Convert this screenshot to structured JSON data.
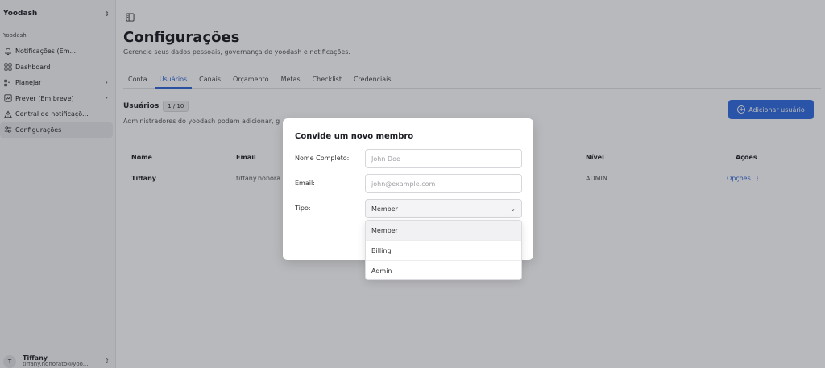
{
  "sidebar": {
    "workspace": "Yoodash",
    "section": "Yoodash",
    "items": [
      {
        "label": "Notificações (Em..."
      },
      {
        "label": "Dashboard"
      },
      {
        "label": "Planejar"
      },
      {
        "label": "Prever (Em breve)"
      },
      {
        "label": "Central de notificaçõ..."
      },
      {
        "label": "Configurações"
      }
    ],
    "user": {
      "initial": "T",
      "name": "Tiffany",
      "email": "tiffany.honorato@yoo..."
    }
  },
  "page": {
    "title": "Configurações",
    "subtitle": "Gerencie seus dados pessoais, governança do yoodash e notificações."
  },
  "tabs": [
    "Conta",
    "Usuários",
    "Canais",
    "Orçamento",
    "Metas",
    "Checklist",
    "Credenciais"
  ],
  "users": {
    "label": "Usuários",
    "count": "1 / 10",
    "description": "Administradores do yoodash podem adicionar, g",
    "add_button": "Adicionar usuário"
  },
  "table": {
    "headers": {
      "name": "Nome",
      "email": "Email",
      "level": "Nível",
      "actions": "Ações"
    },
    "rows": [
      {
        "name": "Tiffany",
        "email": "tiffany.honora",
        "level": "ADMIN",
        "action": "Opções"
      }
    ]
  },
  "modal": {
    "title": "Convide um novo membro",
    "name_label": "Nome Completo:",
    "name_placeholder": "John Doe",
    "email_label": "Email:",
    "email_placeholder": "john@example.com",
    "type_label": "Tipo:",
    "type_value": "Member",
    "options": [
      "Member",
      "Billing",
      "Admin"
    ]
  },
  "colors": {
    "accent": "#2f6ae0",
    "overlay": "rgba(35,38,46,0.32)"
  }
}
